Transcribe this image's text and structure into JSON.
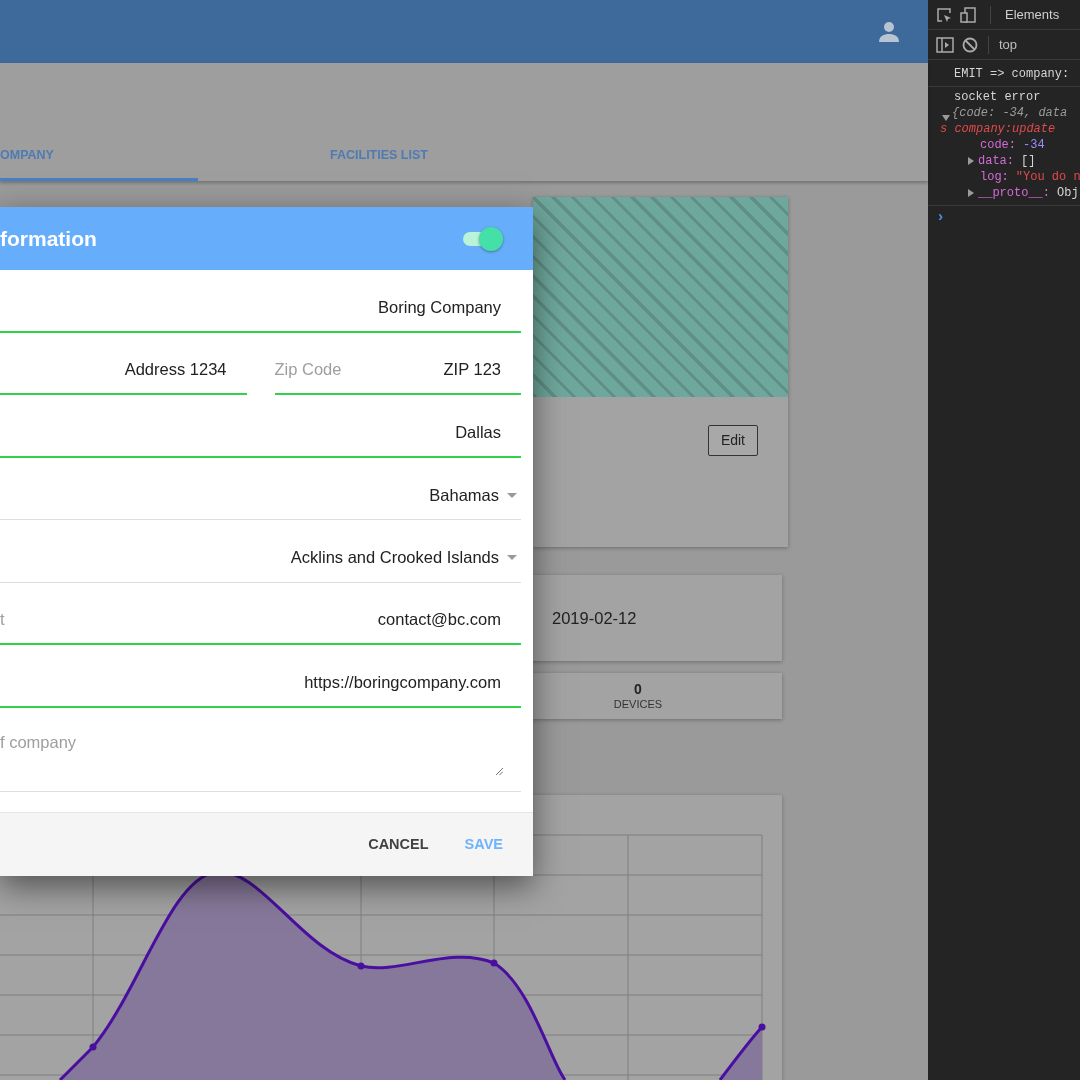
{
  "app": {
    "tabs": [
      {
        "label": "OMPANY",
        "selected": true
      },
      {
        "label": "FACILITIES LIST",
        "selected": false
      }
    ],
    "company_card": {
      "edit_button": "Edit"
    },
    "date": "2019-02-12",
    "stats": [
      {
        "value": "0",
        "label": "DEVICES"
      }
    ]
  },
  "dialog": {
    "title": "formation",
    "toggle": {
      "on": true
    },
    "rows": [
      [
        {
          "kind": "text",
          "value": "Boring Company",
          "valid": true
        }
      ],
      [
        {
          "kind": "text",
          "value": "Address 1234",
          "valid": true
        },
        {
          "kind": "text",
          "label": "Zip Code",
          "value": "ZIP 123",
          "valid": true
        }
      ],
      [
        {
          "kind": "text",
          "value": "Dallas",
          "valid": true
        }
      ],
      [
        {
          "kind": "select",
          "value": "Bahamas",
          "valid": false
        }
      ],
      [
        {
          "kind": "select",
          "value": "Acklins and Crooked Islands",
          "valid": false
        }
      ],
      [
        {
          "kind": "text",
          "label": "t",
          "value": "contact@bc.com",
          "valid": true
        }
      ],
      [
        {
          "kind": "text",
          "value": "https://boringcompany.com",
          "valid": true
        }
      ],
      [
        {
          "kind": "textarea",
          "placeholder": "f company",
          "valid": false
        }
      ]
    ],
    "buttons": [
      {
        "label": "CANCEL",
        "kind": "secondary"
      },
      {
        "label": "SAVE",
        "kind": "primary"
      }
    ]
  },
  "devtools": {
    "tabs": [
      {
        "label": "Elements",
        "selected": true
      }
    ],
    "context": "top",
    "console": [
      {
        "kind": "log",
        "text": "EMIT =>  company:"
      },
      {
        "kind": "object",
        "text": "socket error",
        "summary": "{code: -34, data",
        "summary_tail": "s company:update",
        "expanded": true,
        "properties": [
          {
            "key": "code:",
            "value": "-34",
            "kind": "number",
            "expandable": false
          },
          {
            "key": "data:",
            "value": "[]",
            "kind": "plain",
            "expandable": true
          },
          {
            "key": "log:",
            "value": "\"You do n",
            "kind": "string",
            "expandable": false
          },
          {
            "key": "__proto__:",
            "value": "Obj",
            "kind": "plain",
            "expandable": true
          }
        ]
      }
    ],
    "prompt": "›"
  }
}
